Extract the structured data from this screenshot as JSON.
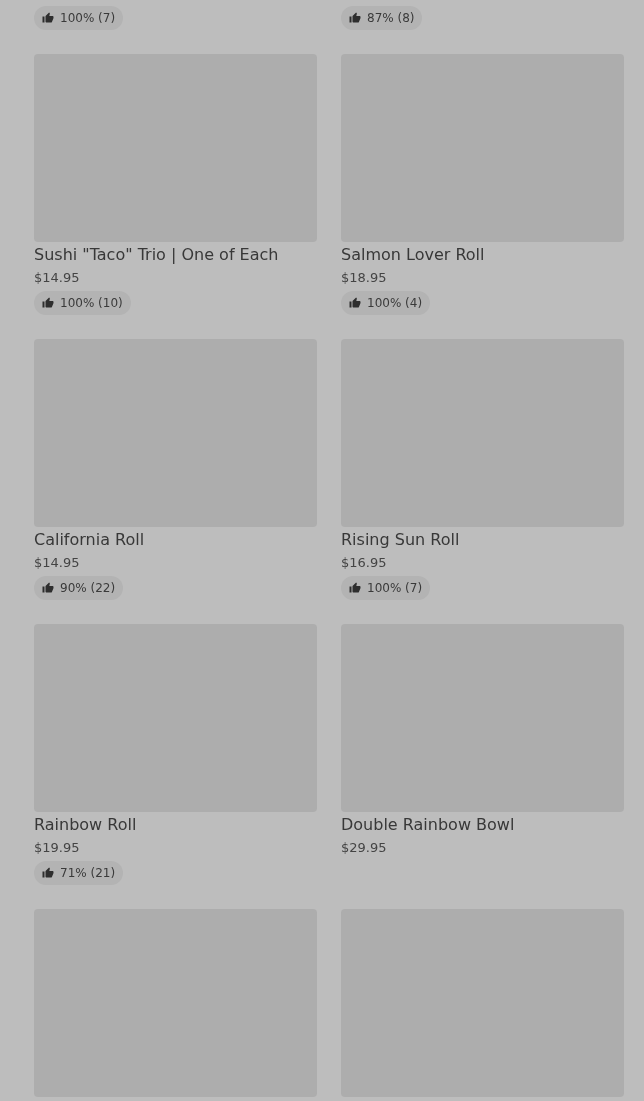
{
  "items": [
    {
      "kind": "rating_only",
      "rating": "100% (7)"
    },
    {
      "kind": "rating_only",
      "rating": "87% (8)"
    },
    {
      "kind": "card",
      "title": "Sushi \"Taco\" Trio | One of Each",
      "price": "$14.95",
      "rating": "100% (10)"
    },
    {
      "kind": "card",
      "title": "Salmon Lover Roll",
      "price": "$18.95",
      "rating": "100% (4)"
    },
    {
      "kind": "card",
      "title": "California Roll",
      "price": "$14.95",
      "rating": "90% (22)"
    },
    {
      "kind": "card",
      "title": "Rising Sun Roll",
      "price": "$16.95",
      "rating": "100% (7)"
    },
    {
      "kind": "card",
      "title": "Rainbow Roll",
      "price": "$19.95",
      "rating": "71% (21)"
    },
    {
      "kind": "card",
      "title": "Double Rainbow Bowl",
      "price": "$29.95"
    },
    {
      "kind": "image_only"
    },
    {
      "kind": "image_only"
    }
  ]
}
